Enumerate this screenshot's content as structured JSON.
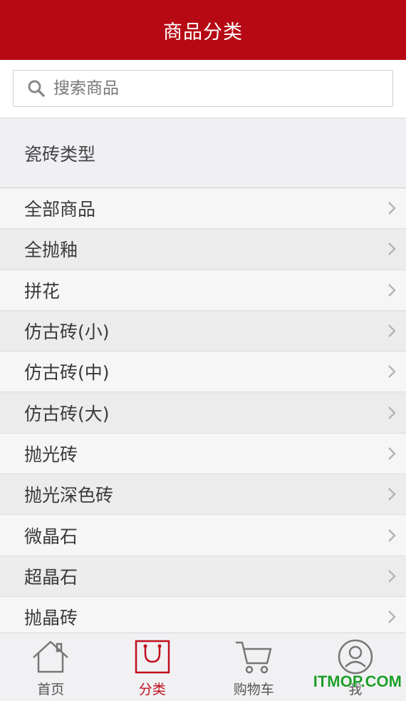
{
  "header": {
    "title": "商品分类"
  },
  "search": {
    "placeholder": "搜索商品"
  },
  "section": {
    "title": "瓷砖类型"
  },
  "categories": [
    {
      "label": "全部商品"
    },
    {
      "label": "全抛釉"
    },
    {
      "label": "拼花"
    },
    {
      "label": "仿古砖(小)"
    },
    {
      "label": "仿古砖(中)"
    },
    {
      "label": "仿古砖(大)"
    },
    {
      "label": "抛光砖"
    },
    {
      "label": "抛光深色砖"
    },
    {
      "label": "微晶石"
    },
    {
      "label": "超晶石"
    },
    {
      "label": "抛晶砖"
    }
  ],
  "tabbar": {
    "tabs": [
      {
        "label": "首页",
        "icon": "home-icon"
      },
      {
        "label": "分类",
        "icon": "shopping-bag-icon",
        "active": true
      },
      {
        "label": "购物车",
        "icon": "cart-icon"
      },
      {
        "label": "我",
        "icon": "user-icon"
      }
    ]
  },
  "watermark": {
    "text": "ITMOP.COM"
  },
  "colors": {
    "brand": "#b60914",
    "active_tab": "#c0101c",
    "watermark": "#1e9e2a"
  }
}
